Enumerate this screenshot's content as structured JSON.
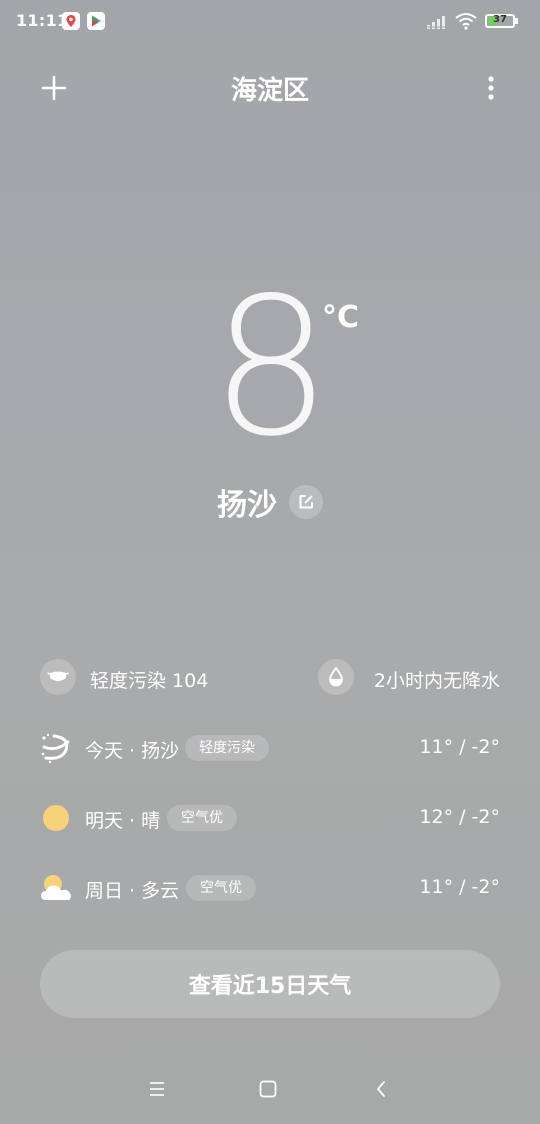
{
  "status_bar": {
    "time": "11:11",
    "battery": "37",
    "battery_level": 0.37,
    "notification_icons": [
      "map-pin-app-icon",
      "play-store-icon"
    ]
  },
  "header": {
    "location": "海淀区",
    "add_icon": "plus-icon",
    "more_icon": "more-vertical-icon"
  },
  "current": {
    "temperature": "8",
    "unit": "°C",
    "condition": "扬沙",
    "edit_icon": "edit-icon"
  },
  "info": {
    "air_quality": "轻度污染 104",
    "air_icon": "mask-icon",
    "precipitation": "2小时内无降水",
    "rain_icon": "raindrop-icon"
  },
  "forecast": [
    {
      "label": "今天 · 扬沙",
      "badge": "轻度污染",
      "temp": "11° / -2°",
      "icon": "sandstorm-icon"
    },
    {
      "label": "明天 · 晴",
      "badge": "空气优",
      "temp": "12° / -2°",
      "icon": "sun-icon"
    },
    {
      "label": "周日 · 多云",
      "badge": "空气优",
      "temp": "11° / -2°",
      "icon": "partly-cloudy-icon"
    }
  ],
  "button_15day": "查看近15日天气",
  "colors": {
    "sun": "#f7d27a",
    "battery_fill": "#6fd15a",
    "text": "#ffffff"
  }
}
